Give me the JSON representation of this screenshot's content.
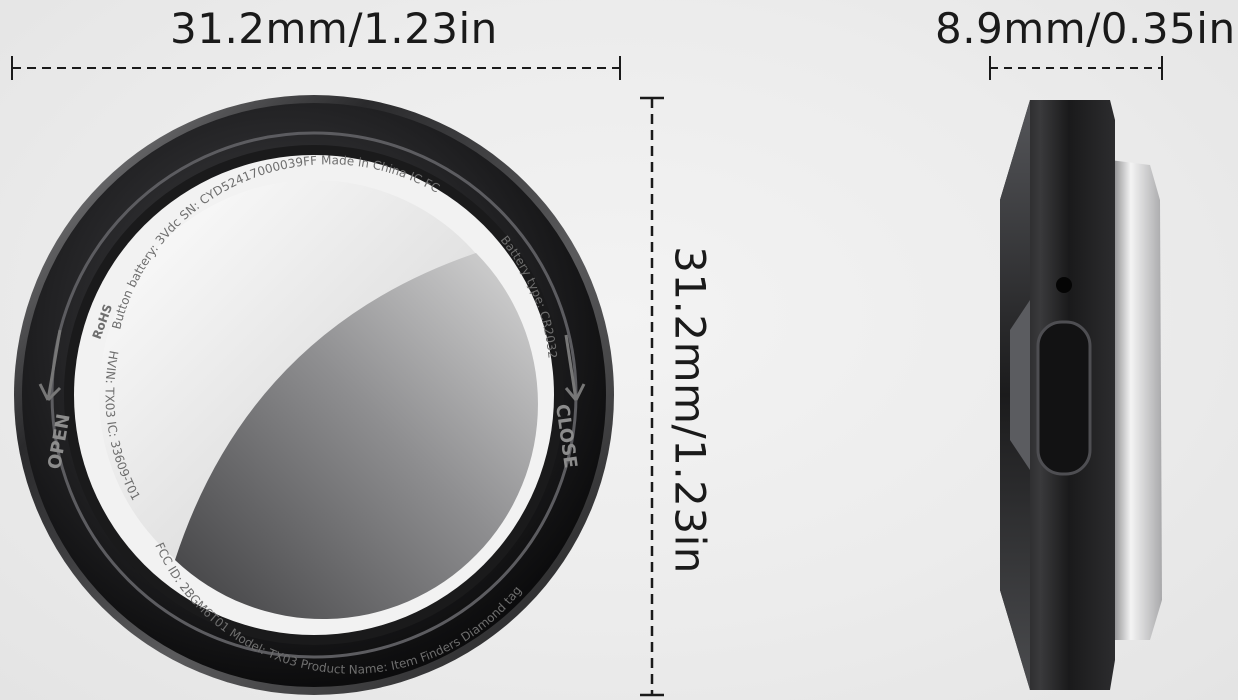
{
  "dimensions": {
    "width": "31.2mm/1.23in",
    "height": "31.2mm/1.23in",
    "depth": "8.9mm/0.35in"
  },
  "bezel": {
    "open_label": "OPEN",
    "close_label": "CLOSE"
  },
  "back_text": {
    "top_arc": "Button battery: 3Vdc   SN: CYD52417000039FF   Made in China IC FC",
    "right_arc": "Battery type: CR2032",
    "bottom_arc": "FCC ID: 2BGM6T01  Model: TX03  Product Name: Item Finders Diamond tag",
    "left_arc": "HVIN: TX03   IC: 33609-T01",
    "rohs": "RoHS"
  },
  "colors": {
    "background": "#ececec",
    "bezel": "#1c1c1e",
    "plate": "#d9d9d9",
    "dim_line": "#1a1a1a"
  }
}
